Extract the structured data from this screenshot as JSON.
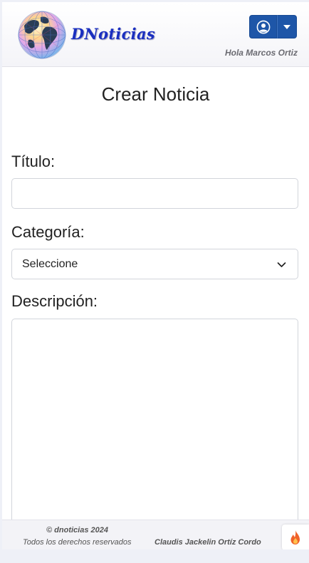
{
  "header": {
    "brand": "DNoticias",
    "greeting": "Hola Marcos Ortiz",
    "user_icon": "user-circle-icon",
    "caret_icon": "caret-down-icon",
    "accent_color": "#1e56a8"
  },
  "form": {
    "title": "Crear Noticia",
    "titulo_label": "Título:",
    "titulo_value": "",
    "categoria_label": "Categoría:",
    "categoria_selected": "Seleccione",
    "descripcion_label": "Descripción:",
    "descripcion_value": ""
  },
  "footer": {
    "copyright": "© dnoticias 2024",
    "rights": "Todos los derechos reservados",
    "author": "Claudis Jackelin Ortíz Cordo",
    "flame_icon": "flame-icon"
  }
}
